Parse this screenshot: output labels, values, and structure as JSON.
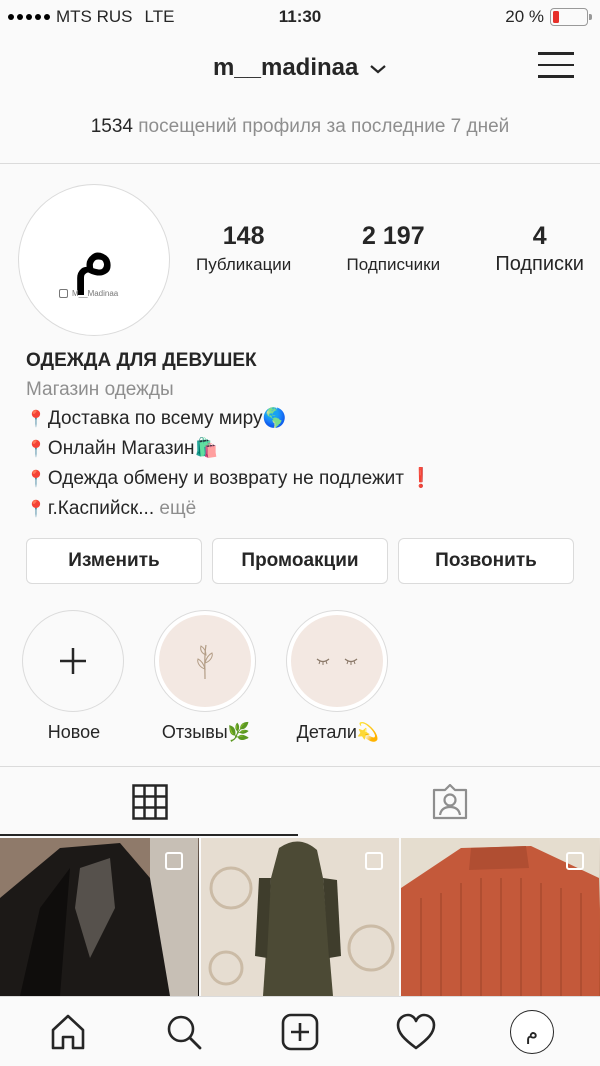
{
  "status_bar": {
    "carrier": "MTS RUS",
    "network": "LTE",
    "time": "11:30",
    "battery_text": "20 %",
    "battery_level": 0.2
  },
  "header": {
    "username": "m__madinaa"
  },
  "visits": {
    "count": "1534",
    "text": "посещений профиля за последние 7 дней"
  },
  "profile": {
    "avatar_glyph": "م",
    "avatar_tag": "M__Madinaa",
    "stats": [
      {
        "value": "148",
        "label": "Публикации"
      },
      {
        "value": "2 197",
        "label": "Подписчики"
      },
      {
        "value": "4",
        "label": "Подписки"
      }
    ]
  },
  "bio": {
    "name": "ОДЕЖДА ДЛЯ ДЕВУШЕК",
    "category": "Магазин одежды",
    "lines": [
      "Доставка по всему миру🌎",
      "Онлайн Магазин🛍️",
      "Одежда обмену и возврату не подлежит ❗",
      "г.Каспийск..."
    ],
    "more": "ещё"
  },
  "actions": {
    "edit": "Изменить",
    "promo": "Промоакции",
    "call": "Позвонить"
  },
  "highlights": [
    {
      "label": "Новое"
    },
    {
      "label": "Отзывы🌿"
    },
    {
      "label": "Детали💫"
    }
  ],
  "icons": {
    "home": "home-icon",
    "search": "search-icon",
    "add": "add-post-icon",
    "activity": "heart-icon",
    "grid": "grid-icon",
    "tagged": "tagged-icon",
    "menu": "menu-icon"
  },
  "colors": {
    "battery_low": "#e7302a",
    "pin": "#e0443e",
    "highlight_bg": "#f3e8e2"
  }
}
